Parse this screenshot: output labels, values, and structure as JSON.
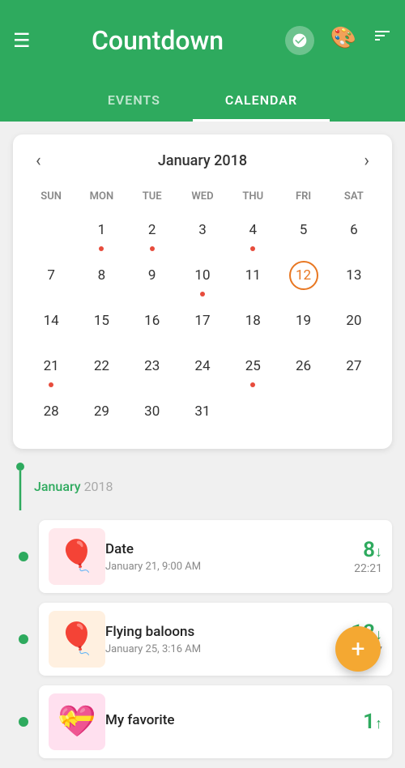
{
  "header": {
    "menu_icon": "☰",
    "title": "Countdown",
    "check_icon": "✓",
    "palette_icon": "🎨",
    "sort_icon": "≡"
  },
  "tabs": [
    {
      "label": "EVENTS",
      "active": false
    },
    {
      "label": "CALENDAR",
      "active": true
    }
  ],
  "calendar": {
    "month_title": "January 2018",
    "prev_icon": "‹",
    "next_icon": "›",
    "weekdays": [
      "SUN",
      "MON",
      "TUE",
      "WED",
      "THU",
      "FRI",
      "SAT"
    ],
    "weeks": [
      [
        {
          "num": "",
          "dot": false,
          "today": false
        },
        {
          "num": "1",
          "dot": true,
          "today": false
        },
        {
          "num": "2",
          "dot": true,
          "today": false
        },
        {
          "num": "3",
          "dot": false,
          "today": false
        },
        {
          "num": "4",
          "dot": true,
          "today": false
        },
        {
          "num": "5",
          "dot": false,
          "today": false
        },
        {
          "num": "6",
          "dot": false,
          "today": false
        }
      ],
      [
        {
          "num": "7",
          "dot": false,
          "today": false
        },
        {
          "num": "8",
          "dot": false,
          "today": false
        },
        {
          "num": "9",
          "dot": false,
          "today": false
        },
        {
          "num": "10",
          "dot": true,
          "today": false
        },
        {
          "num": "11",
          "dot": false,
          "today": false
        },
        {
          "num": "12",
          "dot": false,
          "today": true
        },
        {
          "num": "13",
          "dot": false,
          "today": false
        }
      ],
      [
        {
          "num": "14",
          "dot": false,
          "today": false
        },
        {
          "num": "15",
          "dot": false,
          "today": false
        },
        {
          "num": "16",
          "dot": false,
          "today": false
        },
        {
          "num": "17",
          "dot": false,
          "today": false
        },
        {
          "num": "18",
          "dot": false,
          "today": false
        },
        {
          "num": "19",
          "dot": false,
          "today": false
        },
        {
          "num": "20",
          "dot": false,
          "today": false
        }
      ],
      [
        {
          "num": "21",
          "dot": true,
          "today": false
        },
        {
          "num": "22",
          "dot": false,
          "today": false
        },
        {
          "num": "23",
          "dot": false,
          "today": false
        },
        {
          "num": "24",
          "dot": false,
          "today": false
        },
        {
          "num": "25",
          "dot": true,
          "today": false
        },
        {
          "num": "26",
          "dot": false,
          "today": false
        },
        {
          "num": "27",
          "dot": false,
          "today": false
        }
      ],
      [
        {
          "num": "28",
          "dot": false,
          "today": false
        },
        {
          "num": "29",
          "dot": false,
          "today": false
        },
        {
          "num": "30",
          "dot": false,
          "today": false
        },
        {
          "num": "31",
          "dot": false,
          "today": false
        },
        {
          "num": "",
          "dot": false,
          "today": false
        },
        {
          "num": "",
          "dot": false,
          "today": false
        },
        {
          "num": "",
          "dot": false,
          "today": false
        }
      ]
    ]
  },
  "events_section": {
    "month": "January",
    "year": "2018",
    "events": [
      {
        "name": "Date",
        "date": "January 21, 9:00 AM",
        "days": "8",
        "time_remain": "22:21",
        "direction": "down",
        "emoji": "🎈",
        "bg": "balloon"
      },
      {
        "name": "Flying baloons",
        "date": "January 25, 3:16 AM",
        "days": "12",
        "time_remain": "17",
        "direction": "down",
        "emoji": "🎈",
        "bg": "hotair"
      },
      {
        "name": "My favorite",
        "date": "",
        "days": "1",
        "time_remain": "",
        "direction": "up",
        "emoji": "💝",
        "bg": "heart"
      }
    ]
  },
  "fab": {
    "label": "+"
  }
}
